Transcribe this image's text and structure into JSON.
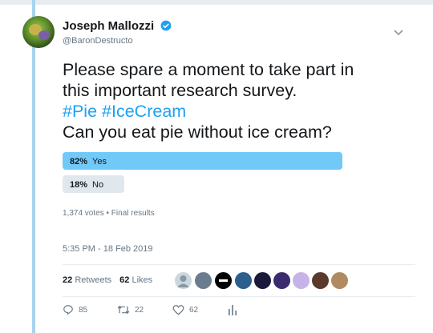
{
  "tweet": {
    "author_name": "Joseph Mallozzi",
    "author_handle": "@BaronDestructo",
    "text_line1": "Please spare a moment to take part in",
    "text_line2": "this important research survey.",
    "hashtags": [
      "#Pie",
      "#IceCream"
    ],
    "text_line4": "Can you eat pie without ice cream?",
    "timestamp": "5:35 PM - 18 Feb 2019"
  },
  "poll": {
    "options": [
      {
        "percent": "82%",
        "label": "Yes",
        "share": 0.82
      },
      {
        "percent": "18%",
        "label": "No",
        "share": 0.18
      }
    ],
    "votes": "1,374 votes",
    "separator": "•",
    "status": "Final results"
  },
  "stats": {
    "retweets_count": "22",
    "retweets_label": "Retweets",
    "likes_count": "62",
    "likes_label": "Likes"
  },
  "actions": {
    "reply_count": "85",
    "retweet_count": "22",
    "like_count": "62"
  },
  "colors": {
    "accent": "#1da1f2",
    "winning_bar": "#71c9f8",
    "losing_bar": "#e1e8ed",
    "thread_line": "#a9d4ef"
  }
}
